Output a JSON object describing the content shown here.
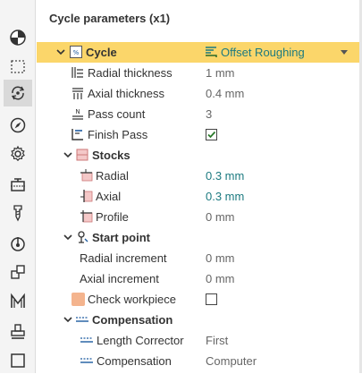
{
  "panel": {
    "title": "Cycle parameters (x1)"
  },
  "toolbar": {
    "tools": [
      {
        "name": "material-tool",
        "icon": "half-circle-icon"
      },
      {
        "name": "stock-tool",
        "icon": "dashed-box-icon"
      },
      {
        "name": "cycle-tool",
        "icon": "rotate-arrows-icon",
        "active": true
      },
      {
        "name": "compass-tool",
        "icon": "compass-icon"
      },
      {
        "name": "settings-tool",
        "icon": "gear-icon"
      },
      {
        "name": "workpiece-tool",
        "icon": "clamp-icon"
      },
      {
        "name": "cutter-tool",
        "icon": "drill-icon"
      },
      {
        "name": "probe-tool",
        "icon": "target-icon"
      },
      {
        "name": "shapes-tool",
        "icon": "stacked-squares-icon"
      },
      {
        "name": "macro-tool",
        "icon": "m-letter-icon"
      },
      {
        "name": "stamp-tool",
        "icon": "stamp-icon"
      },
      {
        "name": "frame-tool",
        "icon": "square-icon"
      }
    ]
  },
  "cycle": {
    "label": "Cycle",
    "value": "Offset Roughing",
    "radial_thickness_label": "Radial thickness",
    "radial_thickness_value": "1 mm",
    "axial_thickness_label": "Axial thickness",
    "axial_thickness_value": "0.4 mm",
    "pass_count_label": "Pass count",
    "pass_count_value": "3",
    "finish_pass_label": "Finish Pass",
    "finish_pass_checked": true
  },
  "stocks": {
    "label": "Stocks",
    "radial_label": "Radial",
    "radial_value": "0.3 mm",
    "axial_label": "Axial",
    "axial_value": "0.3 mm",
    "profile_label": "Profile",
    "profile_value": "0 mm"
  },
  "start_point": {
    "label": "Start point",
    "radial_increment_label": "Radial increment",
    "radial_increment_value": "0 mm",
    "axial_increment_label": "Axial increment",
    "axial_increment_value": "0 mm"
  },
  "check_workpiece": {
    "label": "Check workpiece",
    "checked": false,
    "swatch_color": "#f4b48e"
  },
  "compensation": {
    "label": "Compensation",
    "length_corrector_label": "Length Corrector",
    "length_corrector_value": "First",
    "compensation_label": "Compensation",
    "compensation_value": "Computer"
  },
  "colors": {
    "highlight": "#fbd66a",
    "teal_value": "#1c7a80"
  }
}
